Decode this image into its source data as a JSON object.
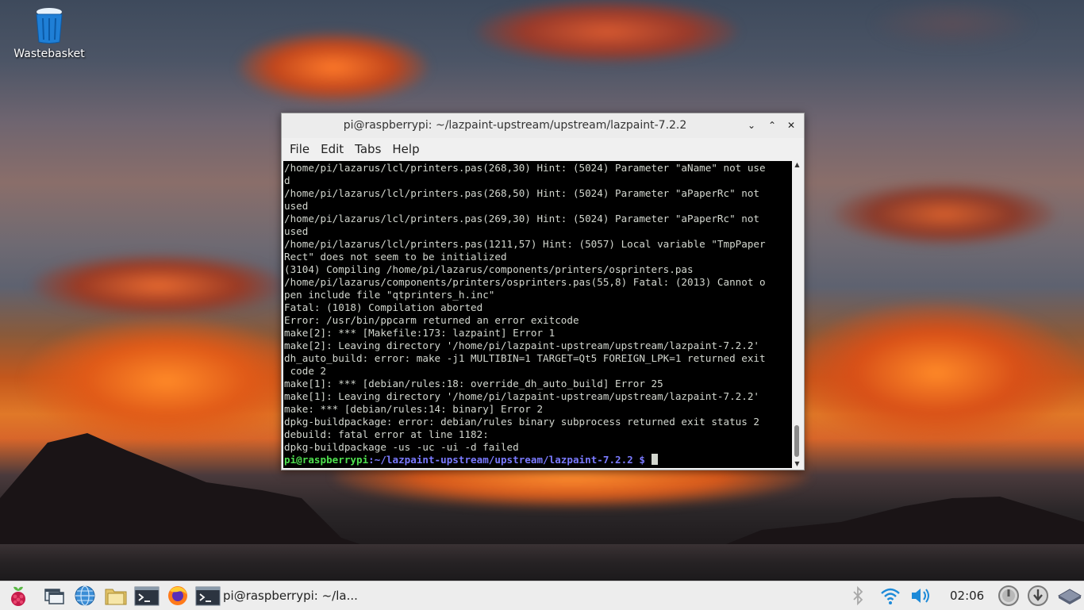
{
  "desktop": {
    "icons": [
      {
        "label": "Wastebasket",
        "icon": "trash-can-icon"
      }
    ]
  },
  "window": {
    "title": "pi@raspberrypi: ~/lazpaint-upstream/upstream/lazpaint-7.2.2",
    "controls": {
      "minimize": "⌄",
      "maximize": "⌃",
      "close": "✕"
    },
    "menu": [
      "File",
      "Edit",
      "Tabs",
      "Help"
    ],
    "terminal": {
      "lines": [
        "/home/pi/lazarus/lcl/printers.pas(268,30) Hint: (5024) Parameter \"aName\" not use",
        "d",
        "/home/pi/lazarus/lcl/printers.pas(268,50) Hint: (5024) Parameter \"aPaperRc\" not",
        "used",
        "/home/pi/lazarus/lcl/printers.pas(269,30) Hint: (5024) Parameter \"aPaperRc\" not",
        "used",
        "/home/pi/lazarus/lcl/printers.pas(1211,57) Hint: (5057) Local variable \"TmpPaper",
        "Rect\" does not seem to be initialized",
        "(3104) Compiling /home/pi/lazarus/components/printers/osprinters.pas",
        "/home/pi/lazarus/components/printers/osprinters.pas(55,8) Fatal: (2013) Cannot o",
        "pen include file \"qtprinters_h.inc\"",
        "Fatal: (1018) Compilation aborted",
        "Error: /usr/bin/ppcarm returned an error exitcode",
        "make[2]: *** [Makefile:173: lazpaint] Error 1",
        "make[2]: Leaving directory '/home/pi/lazpaint-upstream/upstream/lazpaint-7.2.2'",
        "dh_auto_build: error: make -j1 MULTIBIN=1 TARGET=Qt5 FOREIGN_LPK=1 returned exit",
        " code 2",
        "make[1]: *** [debian/rules:18: override_dh_auto_build] Error 25",
        "make[1]: Leaving directory '/home/pi/lazpaint-upstream/upstream/lazpaint-7.2.2'",
        "make: *** [debian/rules:14: binary] Error 2",
        "dpkg-buildpackage: error: debian/rules binary subprocess returned exit status 2",
        "debuild: fatal error at line 1182:",
        "dpkg-buildpackage -us -uc -ui -d failed"
      ],
      "prompt_user": "pi@raspberrypi",
      "prompt_path": ":~/lazpaint-upstream/upstream/lazpaint-7.2.2",
      "prompt_symbol": " $ "
    }
  },
  "taskbar": {
    "launchers": [
      "raspberry-menu-icon",
      "show-desktop-icon",
      "web-browser-icon",
      "file-manager-icon",
      "terminal-icon",
      "firefox-icon"
    ],
    "active_task": {
      "icon": "terminal-icon",
      "label": "pi@raspberrypi: ~/la..."
    },
    "tray": [
      "bluetooth-icon",
      "wifi-icon",
      "volume-icon"
    ],
    "clock": "02:06",
    "tray_right": [
      "cpu-monitor-icon",
      "eject-icon",
      "storage-icon"
    ]
  },
  "colors": {
    "prompt_user": "#4ee04e",
    "prompt_path": "#7a7aff",
    "terminal_bg": "#000000",
    "terminal_fg": "#d3d7cf"
  }
}
